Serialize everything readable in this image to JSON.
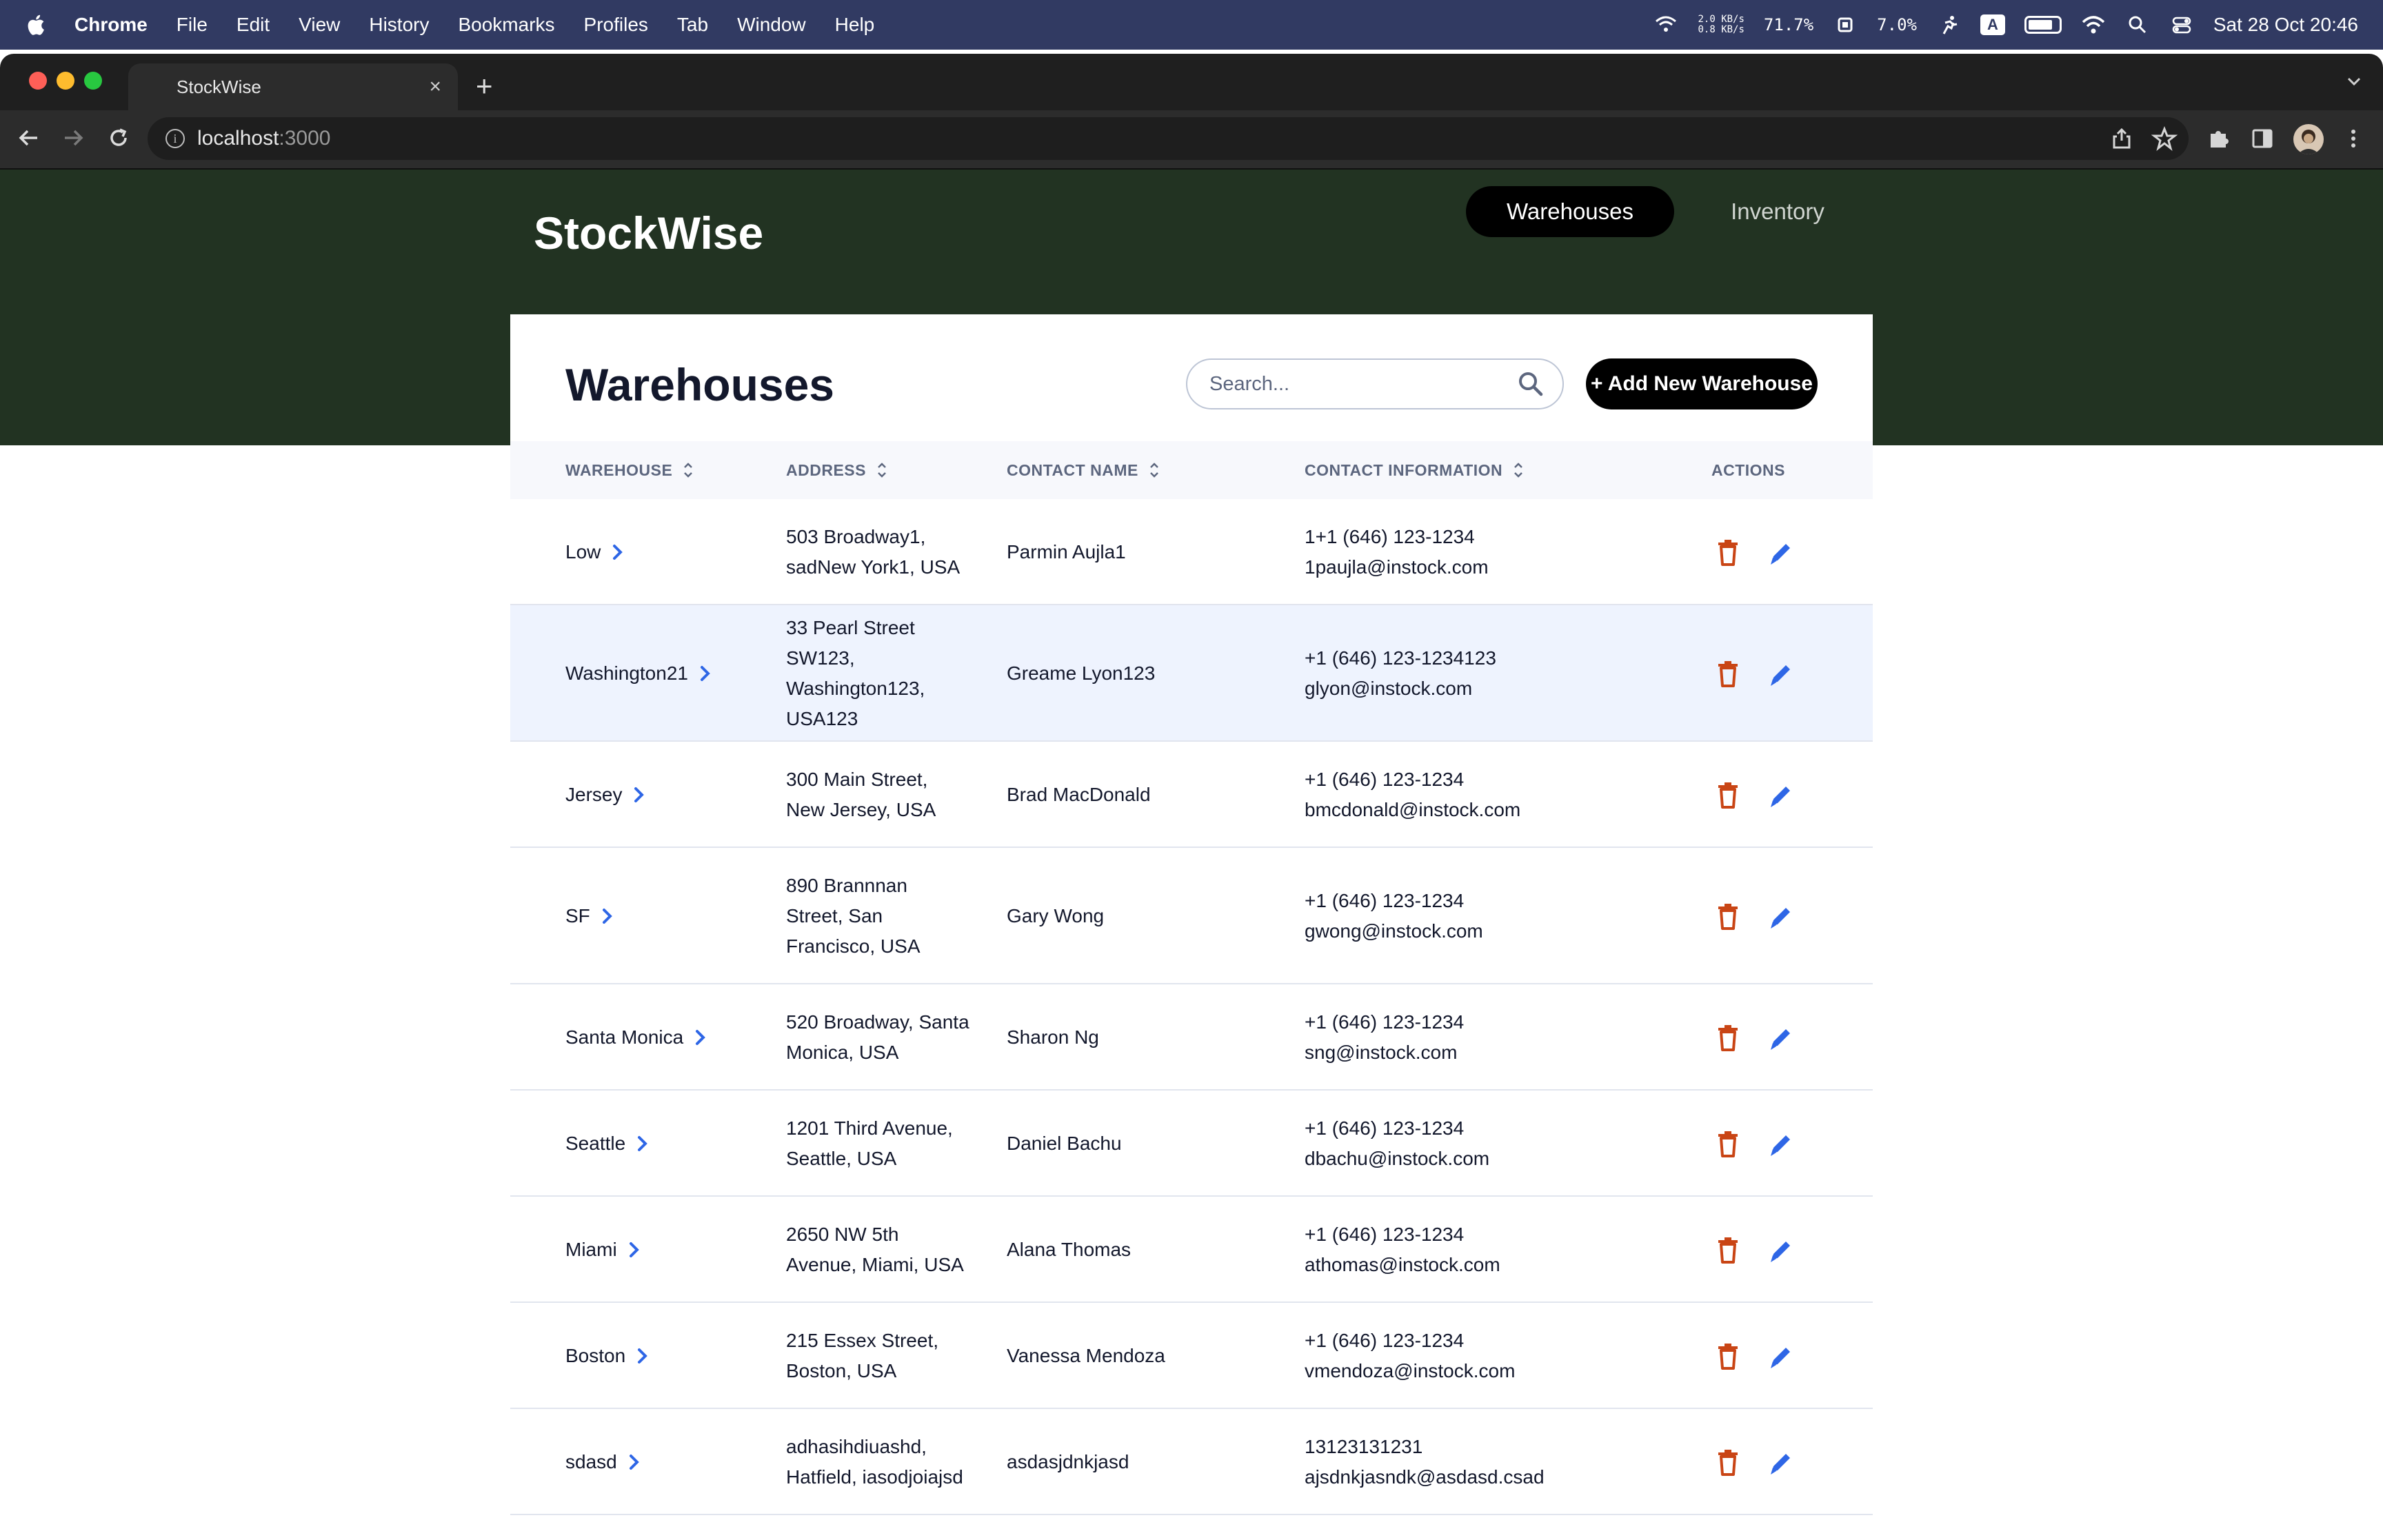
{
  "menubar": {
    "app": "Chrome",
    "items": [
      "File",
      "Edit",
      "View",
      "History",
      "Bookmarks",
      "Profiles",
      "Tab",
      "Window",
      "Help"
    ],
    "net_up": "2.0 KB/s",
    "net_down": "0.8 KB/s",
    "cpu": "71.7%",
    "mem": "7.0%",
    "input_badge": "A",
    "datetime": "Sat 28 Oct  20:46"
  },
  "browser": {
    "tab_title": "StockWise",
    "url_host": "localhost",
    "url_port": ":3000"
  },
  "app": {
    "logo": "StockWise",
    "nav": {
      "warehouses": "Warehouses",
      "inventory": "Inventory"
    }
  },
  "card": {
    "title": "Warehouses",
    "search_placeholder": "Search...",
    "add_button": "+ Add New Warehouse"
  },
  "table": {
    "headers": {
      "warehouse": "WAREHOUSE",
      "address": "ADDRESS",
      "contact_name": "CONTACT NAME",
      "contact_info": "CONTACT INFORMATION",
      "actions": "ACTIONS"
    },
    "rows": [
      {
        "warehouse": "Low",
        "address": [
          "503 Broadway1,",
          "sadNew York1, USA"
        ],
        "contact": "Parmin Aujla1",
        "phone": "1+1 (646) 123-1234",
        "email": "1paujla@instock.com"
      },
      {
        "warehouse": "Washington21",
        "address": [
          "33 Pearl Street",
          "SW123,",
          "Washington123,",
          "USA123"
        ],
        "contact": "Greame Lyon123",
        "phone": "+1 (646) 123-1234123",
        "email": "glyon@instock.com"
      },
      {
        "warehouse": "Jersey",
        "address": [
          "300 Main Street,",
          "New Jersey, USA"
        ],
        "contact": "Brad MacDonald",
        "phone": "+1 (646) 123-1234",
        "email": "bmcdonald@instock.com"
      },
      {
        "warehouse": "SF",
        "address": [
          "890 Brannnan",
          "Street, San",
          "Francisco, USA"
        ],
        "contact": "Gary Wong",
        "phone": "+1 (646) 123-1234",
        "email": "gwong@instock.com"
      },
      {
        "warehouse": "Santa Monica",
        "address": [
          "520 Broadway, Santa",
          "Monica, USA"
        ],
        "contact": "Sharon Ng",
        "phone": "+1 (646) 123-1234",
        "email": "sng@instock.com"
      },
      {
        "warehouse": "Seattle",
        "address": [
          "1201 Third Avenue,",
          "Seattle, USA"
        ],
        "contact": "Daniel Bachu",
        "phone": "+1 (646) 123-1234",
        "email": "dbachu@instock.com"
      },
      {
        "warehouse": "Miami",
        "address": [
          "2650 NW 5th",
          "Avenue, Miami, USA"
        ],
        "contact": "Alana Thomas",
        "phone": "+1 (646) 123-1234",
        "email": "athomas@instock.com"
      },
      {
        "warehouse": "Boston",
        "address": [
          "215 Essex Street,",
          "Boston, USA"
        ],
        "contact": "Vanessa Mendoza",
        "phone": "+1 (646) 123-1234",
        "email": "vmendoza@instock.com"
      },
      {
        "warehouse": "sdasd",
        "address": [
          "adhasihdiuashd,",
          "Hatfield, iasodjoiajsd"
        ],
        "contact": "asdasjdnkjasd",
        "phone": "13123131231",
        "email": "ajsdnkjasndk@asdasd.csad"
      }
    ]
  },
  "colors": {
    "header_bg": "#223322",
    "delete": "#c94515",
    "edit": "#2e66e6",
    "chevron": "#2e66e6",
    "hover_row": "#eef3fe",
    "menubar_bg": "#313a62"
  }
}
